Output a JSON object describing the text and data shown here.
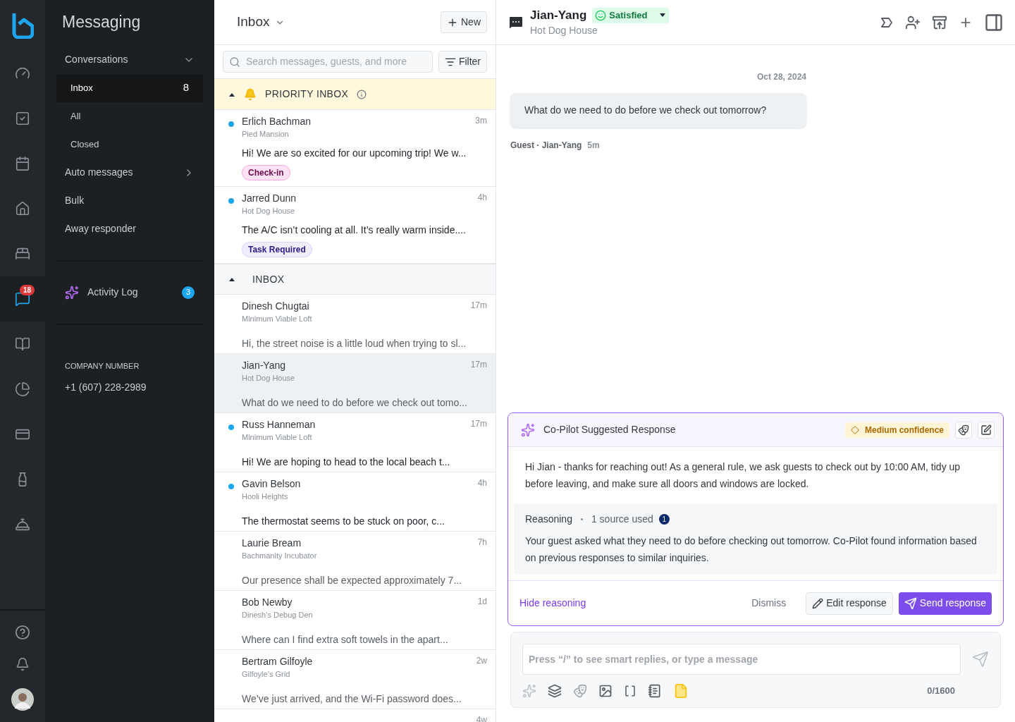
{
  "rail": {
    "items": [
      {
        "kind": "dashboard",
        "selected": false
      },
      {
        "kind": "tasks",
        "selected": false
      },
      {
        "kind": "calendar",
        "selected": false
      },
      {
        "kind": "home",
        "selected": false
      },
      {
        "kind": "bed",
        "selected": false
      },
      {
        "kind": "messages",
        "selected": true,
        "badge": "18"
      },
      {
        "kind": "book",
        "selected": false
      },
      {
        "kind": "chart",
        "selected": false
      },
      {
        "kind": "card",
        "selected": false
      },
      {
        "kind": "amenities",
        "selected": false
      },
      {
        "kind": "service-bell",
        "selected": false
      }
    ],
    "bottom": [
      {
        "kind": "help"
      },
      {
        "kind": "bell"
      },
      {
        "kind": "avatar"
      }
    ]
  },
  "sidebar": {
    "title": "Messaging",
    "sections": [
      {
        "label": "Conversations",
        "kind": "group",
        "expanded": true,
        "children": [
          {
            "label": "Inbox",
            "count": "8",
            "selected": true
          },
          {
            "label": "All",
            "selected": false
          },
          {
            "label": "Closed",
            "selected": false
          }
        ]
      },
      {
        "label": "Auto messages",
        "kind": "group",
        "expanded": false
      },
      {
        "label": "Bulk",
        "kind": "link"
      },
      {
        "label": "Away responder",
        "kind": "link"
      }
    ],
    "activity_log": {
      "label": "Activity Log",
      "badge": "3"
    },
    "company_number": {
      "label": "COMPANY NUMBER",
      "value": "+1 (607) 228-2989"
    }
  },
  "list": {
    "title": "Inbox",
    "new_button": "New",
    "search": {
      "placeholder": "Search messages, guests, and more"
    },
    "filter_button": "Filter",
    "groups": [
      {
        "title": "PRIORITY INBOX",
        "kind": "priority",
        "expanded": true,
        "conversations": [
          {
            "name": "Erlich Bachman",
            "property": "Pied Mansion",
            "time": "3m",
            "preview": "Hi! We are so excited for our upcoming trip! We w...",
            "unread": true,
            "selected": false,
            "tag": {
              "label": "Check-in",
              "kind": "checkin"
            }
          },
          {
            "name": "Jarred Dunn",
            "property": "Hot Dog House",
            "time": "4h",
            "preview": "The A/C isn’t cooling at all. It’s really warm inside....",
            "unread": true,
            "selected": false,
            "tag": {
              "label": "Task Required",
              "kind": "task"
            }
          }
        ]
      },
      {
        "title": "INBOX",
        "kind": "regular",
        "expanded": true,
        "conversations": [
          {
            "name": "Dinesh Chugtai",
            "property": "Minimum Viable Loft",
            "time": "17m",
            "preview": "Hi, the street noise is a little loud when trying to sl...",
            "unread": false,
            "selected": false
          },
          {
            "name": "Jian-Yang",
            "property": "Hot Dog House",
            "time": "17m",
            "preview": "What do we need to do before we check out tomo...",
            "unread": false,
            "selected": true
          },
          {
            "name": "Russ Hanneman",
            "property": "Minimum Viable Loft",
            "time": "17m",
            "preview": "Hi! We are hoping to head to the local beach t...",
            "unread": true,
            "selected": false
          },
          {
            "name": "Gavin Belson",
            "property": "Hooli Heights",
            "time": "4h",
            "preview": "The thermostat seems to be stuck on poor, c...",
            "unread": true,
            "selected": false
          },
          {
            "name": "Laurie Bream",
            "property": "Bachmanity Incubator",
            "time": "7h",
            "preview": "Our presence shall be expected approximately 7...",
            "unread": false,
            "selected": false
          },
          {
            "name": "Bob Newby",
            "property": "Dinesh’s Debug Den",
            "time": "1d",
            "preview": "Where can I find extra soft towels in the apart...",
            "unread": false,
            "selected": false
          },
          {
            "name": "Bertram Gilfoyle",
            "property": "Gilfoyle’s Grid",
            "time": "2w",
            "preview": "We’ve just arrived, and the Wi-Fi password does...",
            "unread": false,
            "selected": false
          },
          {
            "time": "4w",
            "unread": false,
            "selected": false
          }
        ]
      }
    ]
  },
  "conversation": {
    "name": "Jian-Yang",
    "status": "Satisfied",
    "property": "Hot Dog House",
    "date": "Oct 28, 2024",
    "messages": [
      {
        "text": "What do we need to do before we check out tomorrow?",
        "sender": "Guest · Jian-Yang",
        "time": "5m"
      }
    ],
    "copilot": {
      "title": "Co-Pilot Suggested Response",
      "confidence": "Medium confidence",
      "response": "Hi Jian - thanks for reaching out! As a general rule, we ask guests to check out by 10:00 AM, tidy up before leaving, and make sure all doors and windows are locked.",
      "reasoning_label": "Reasoning",
      "sources": "1 source used",
      "source_count": "1",
      "reasoning": "Your guest asked what they need to do before checking out tomorrow. Co-Pilot found information based on previous responses to similar inquiries.",
      "hide_reasoning": "Hide reasoning",
      "dismiss": "Dismiss",
      "edit": "Edit response",
      "send": "Send response"
    },
    "composer": {
      "placeholder": "Press “/” to see smart replies, or type a message",
      "counter": "0/1600"
    }
  }
}
